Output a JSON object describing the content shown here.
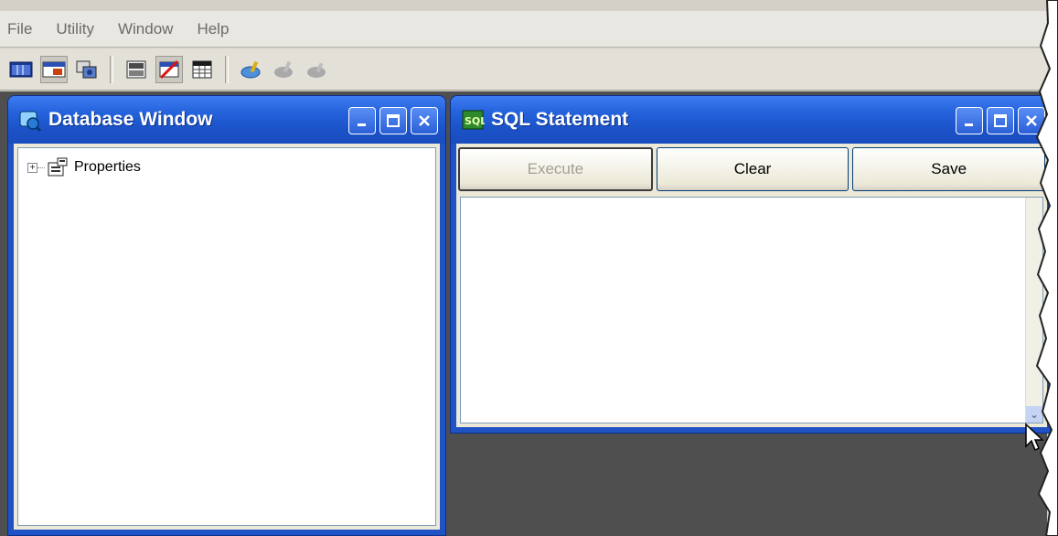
{
  "menu": [
    "File",
    "Utility",
    "Window",
    "Help"
  ],
  "toolbar": {
    "icons": [
      "grid-view-icon",
      "table-view-icon",
      "connect-icon",
      "server-icon",
      "edit-table-icon",
      "sheet-icon",
      "paint-icon",
      "paint-disabled-icon",
      "paint-disabled-icon-2"
    ]
  },
  "database_window": {
    "title": "Database Window",
    "tree": [
      {
        "label": "Properties",
        "expander": "+"
      }
    ]
  },
  "sql_window": {
    "title": "SQL Statement",
    "buttons": {
      "execute": {
        "label": "Execute",
        "enabled": false
      },
      "clear": {
        "label": "Clear",
        "enabled": true
      },
      "save": {
        "label": "Save",
        "enabled": true
      }
    },
    "statement": ""
  },
  "colors": {
    "titlebar": "#2462dc",
    "workspace": "#4f4f4f",
    "menubar": "#e9e7e1"
  }
}
